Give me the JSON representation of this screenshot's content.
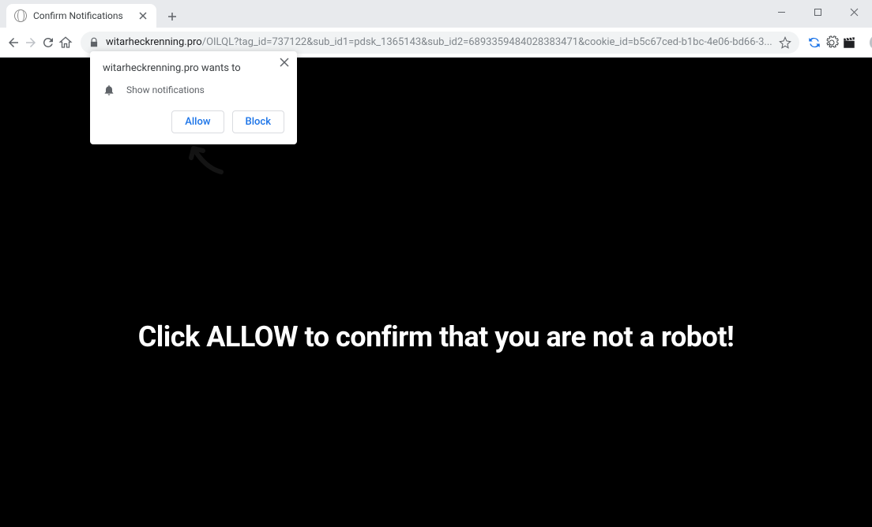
{
  "tab": {
    "title": "Confirm Notifications"
  },
  "url": {
    "domain": "witarheckrenning.pro",
    "path": "/OILQL?tag_id=737122&sub_id1=pdsk_1365143&sub_id2=6893359484028383471&cookie_id=b5c67ced-b1bc-4e06-bd66-3..."
  },
  "permission": {
    "origin_wants": "witarheckrenning.pro wants to",
    "item": "Show notifications",
    "allow": "Allow",
    "block": "Block"
  },
  "page": {
    "headline": "Click ALLOW to confirm that you are not a robot!"
  }
}
